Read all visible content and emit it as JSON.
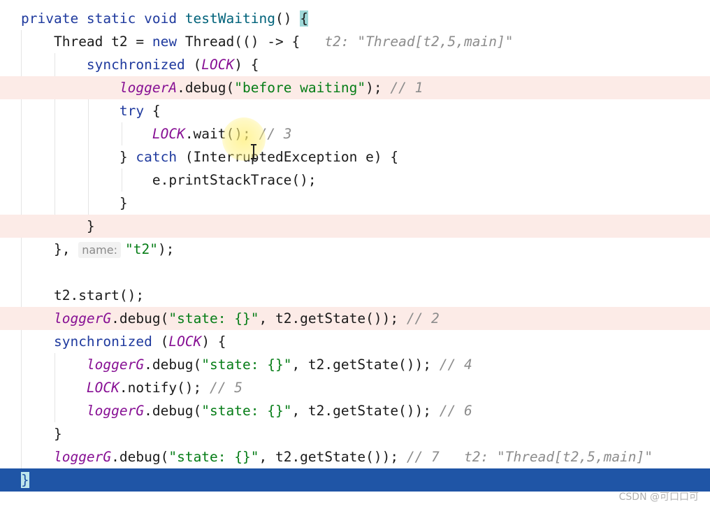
{
  "editor": {
    "language": "java",
    "current_line_color": "#1f55a6",
    "highlight_line_color": "#fcebe7",
    "lines": [
      {
        "indent": 0,
        "tokens": [
          [
            "private static void ",
            "k"
          ],
          [
            "testWaiting",
            "m"
          ],
          [
            "() ",
            ""
          ],
          [
            "{",
            "bm"
          ]
        ]
      },
      {
        "indent": 4,
        "tokens": [
          [
            "Thread t2 = ",
            ""
          ],
          [
            "new",
            "k"
          ],
          [
            " Thread(() -> {",
            ""
          ],
          [
            "   t2: \"Thread[t2,5,main]\"",
            "h"
          ]
        ]
      },
      {
        "indent": 8,
        "tokens": [
          [
            "synchronized",
            "k"
          ],
          [
            " (",
            ""
          ],
          [
            "LOCK",
            "f"
          ],
          [
            ") {",
            ""
          ]
        ]
      },
      {
        "indent": 12,
        "hl": true,
        "tokens": [
          [
            "loggerA",
            "f"
          ],
          [
            ".debug(",
            ""
          ],
          [
            "\"before waiting\"",
            "s"
          ],
          [
            "); ",
            ""
          ],
          [
            "// 1",
            "c"
          ]
        ]
      },
      {
        "indent": 12,
        "tokens": [
          [
            "try",
            "k"
          ],
          [
            " {",
            ""
          ]
        ]
      },
      {
        "indent": 16,
        "tokens": [
          [
            "LOCK",
            "f"
          ],
          [
            ".wait(); ",
            ""
          ],
          [
            "// 3",
            "c"
          ]
        ]
      },
      {
        "indent": 12,
        "tokens": [
          [
            "} ",
            ""
          ],
          [
            "catch",
            "k"
          ],
          [
            " (InterruptedException e) {",
            ""
          ]
        ]
      },
      {
        "indent": 16,
        "tokens": [
          [
            "e.printStackTrace();",
            ""
          ]
        ]
      },
      {
        "indent": 12,
        "tokens": [
          [
            "}",
            ""
          ]
        ]
      },
      {
        "indent": 8,
        "hl": true,
        "tokens": [
          [
            "}",
            ""
          ]
        ]
      },
      {
        "indent": 4,
        "tokens": [
          [
            "}, ",
            ""
          ],
          [
            "name:",
            "n"
          ],
          [
            "\"t2\"",
            "s"
          ],
          [
            ");",
            ""
          ]
        ]
      },
      {
        "indent": 0,
        "tokens": []
      },
      {
        "indent": 4,
        "tokens": [
          [
            "t2.start();",
            ""
          ]
        ]
      },
      {
        "indent": 4,
        "hl": true,
        "tokens": [
          [
            "loggerG",
            "f"
          ],
          [
            ".debug(",
            ""
          ],
          [
            "\"state: {}\"",
            "s"
          ],
          [
            ", t2.getState()); ",
            ""
          ],
          [
            "// 2",
            "c"
          ]
        ]
      },
      {
        "indent": 4,
        "tokens": [
          [
            "synchronized",
            "k"
          ],
          [
            " (",
            ""
          ],
          [
            "LOCK",
            "f"
          ],
          [
            ") {",
            ""
          ]
        ]
      },
      {
        "indent": 8,
        "tokens": [
          [
            "loggerG",
            "f"
          ],
          [
            ".debug(",
            ""
          ],
          [
            "\"state: {}\"",
            "s"
          ],
          [
            ", t2.getState()); ",
            ""
          ],
          [
            "// 4",
            "c"
          ]
        ]
      },
      {
        "indent": 8,
        "tokens": [
          [
            "LOCK",
            "f"
          ],
          [
            ".notify(); ",
            ""
          ],
          [
            "// 5",
            "c"
          ]
        ]
      },
      {
        "indent": 8,
        "tokens": [
          [
            "loggerG",
            "f"
          ],
          [
            ".debug(",
            ""
          ],
          [
            "\"state: {}\"",
            "s"
          ],
          [
            ", t2.getState()); ",
            ""
          ],
          [
            "// 6",
            "c"
          ]
        ]
      },
      {
        "indent": 4,
        "tokens": [
          [
            "}",
            ""
          ]
        ]
      },
      {
        "indent": 4,
        "tokens": [
          [
            "loggerG",
            "f"
          ],
          [
            ".debug(",
            ""
          ],
          [
            "\"state: {}\"",
            "s"
          ],
          [
            ", t2.getState()); ",
            ""
          ],
          [
            "// 7",
            "c"
          ],
          [
            "   t2: \"Thread[t2,5,main]\"",
            "h"
          ]
        ]
      },
      {
        "indent": 0,
        "cur": true,
        "tokens": [
          [
            "}",
            "bm"
          ]
        ]
      }
    ]
  },
  "watermark": "CSDN @可口口可"
}
